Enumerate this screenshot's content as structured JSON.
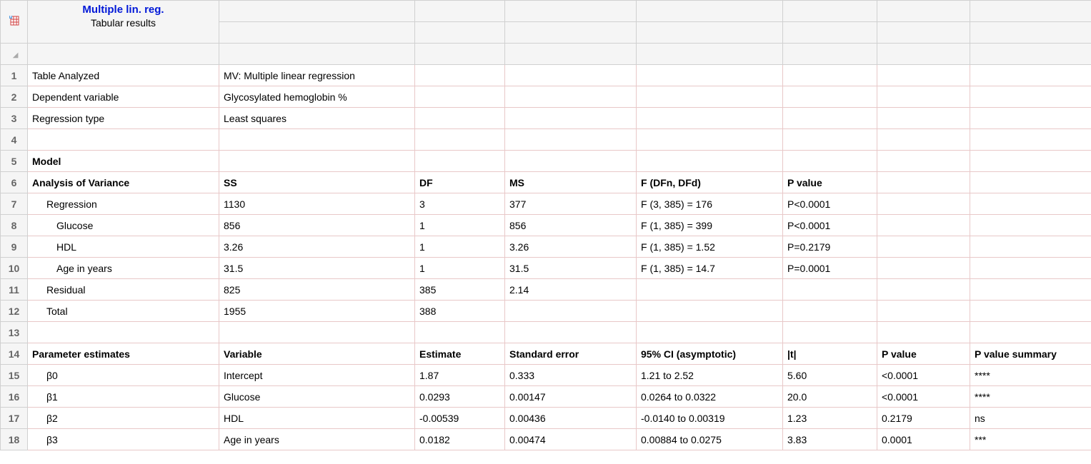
{
  "header": {
    "title": "Multiple lin. reg.",
    "subtitle": "Tabular results"
  },
  "rows": [
    {
      "num": "1",
      "cells": [
        "Table Analyzed",
        "MV: Multiple linear regression",
        "",
        "",
        "",
        "",
        "",
        ""
      ],
      "bold": [],
      "indent": 0
    },
    {
      "num": "2",
      "cells": [
        "Dependent variable",
        "Glycosylated hemoglobin %",
        "",
        "",
        "",
        "",
        "",
        ""
      ],
      "bold": [],
      "indent": 0
    },
    {
      "num": "3",
      "cells": [
        "Regression type",
        "Least squares",
        "",
        "",
        "",
        "",
        "",
        ""
      ],
      "bold": [],
      "indent": 0
    },
    {
      "num": "4",
      "cells": [
        "",
        "",
        "",
        "",
        "",
        "",
        "",
        ""
      ],
      "bold": [],
      "indent": 0
    },
    {
      "num": "5",
      "cells": [
        "Model",
        "",
        "",
        "",
        "",
        "",
        "",
        ""
      ],
      "bold": [
        0
      ],
      "indent": 0
    },
    {
      "num": "6",
      "cells": [
        "Analysis of Variance",
        "SS",
        "DF",
        "MS",
        "F (DFn, DFd)",
        "P value",
        "",
        ""
      ],
      "bold": [
        0,
        1,
        2,
        3,
        4,
        5
      ],
      "indent": 0
    },
    {
      "num": "7",
      "cells": [
        "Regression",
        "1130",
        "3",
        "377",
        "F (3, 385) = 176",
        "P<0.0001",
        "",
        ""
      ],
      "bold": [],
      "indent": 1
    },
    {
      "num": "8",
      "cells": [
        "Glucose",
        "856",
        "1",
        "856",
        "F (1, 385) = 399",
        "P<0.0001",
        "",
        ""
      ],
      "bold": [],
      "indent": 2
    },
    {
      "num": "9",
      "cells": [
        "HDL",
        "3.26",
        "1",
        "3.26",
        "F (1, 385) = 1.52",
        "P=0.2179",
        "",
        ""
      ],
      "bold": [],
      "indent": 2
    },
    {
      "num": "10",
      "cells": [
        "Age in years",
        "31.5",
        "1",
        "31.5",
        "F (1, 385) = 14.7",
        "P=0.0001",
        "",
        ""
      ],
      "bold": [],
      "indent": 2
    },
    {
      "num": "11",
      "cells": [
        "Residual",
        "825",
        "385",
        "2.14",
        "",
        "",
        "",
        ""
      ],
      "bold": [],
      "indent": 1
    },
    {
      "num": "12",
      "cells": [
        "Total",
        "1955",
        "388",
        "",
        "",
        "",
        "",
        ""
      ],
      "bold": [],
      "indent": 1
    },
    {
      "num": "13",
      "cells": [
        "",
        "",
        "",
        "",
        "",
        "",
        "",
        ""
      ],
      "bold": [],
      "indent": 0
    },
    {
      "num": "14",
      "cells": [
        "Parameter estimates",
        "Variable",
        "Estimate",
        "Standard error",
        "95% CI (asymptotic)",
        "|t|",
        "P value",
        "P value summary"
      ],
      "bold": [
        0,
        1,
        2,
        3,
        4,
        5,
        6,
        7
      ],
      "indent": 0
    },
    {
      "num": "15",
      "cells": [
        "β0",
        "Intercept",
        "1.87",
        "0.333",
        "1.21 to 2.52",
        "5.60",
        "<0.0001",
        "****"
      ],
      "bold": [],
      "indent": 1
    },
    {
      "num": "16",
      "cells": [
        "β1",
        "Glucose",
        "0.0293",
        "0.00147",
        "0.0264 to 0.0322",
        "20.0",
        "<0.0001",
        "****"
      ],
      "bold": [],
      "indent": 1
    },
    {
      "num": "17",
      "cells": [
        "β2",
        "HDL",
        "-0.00539",
        "0.00436",
        "-0.0140 to 0.00319",
        "1.23",
        "0.2179",
        "ns"
      ],
      "bold": [],
      "indent": 1
    },
    {
      "num": "18",
      "cells": [
        "β3",
        "Age in years",
        "0.0182",
        "0.00474",
        "0.00884 to 0.0275",
        "3.83",
        "0.0001",
        "***"
      ],
      "bold": [],
      "indent": 1
    }
  ]
}
